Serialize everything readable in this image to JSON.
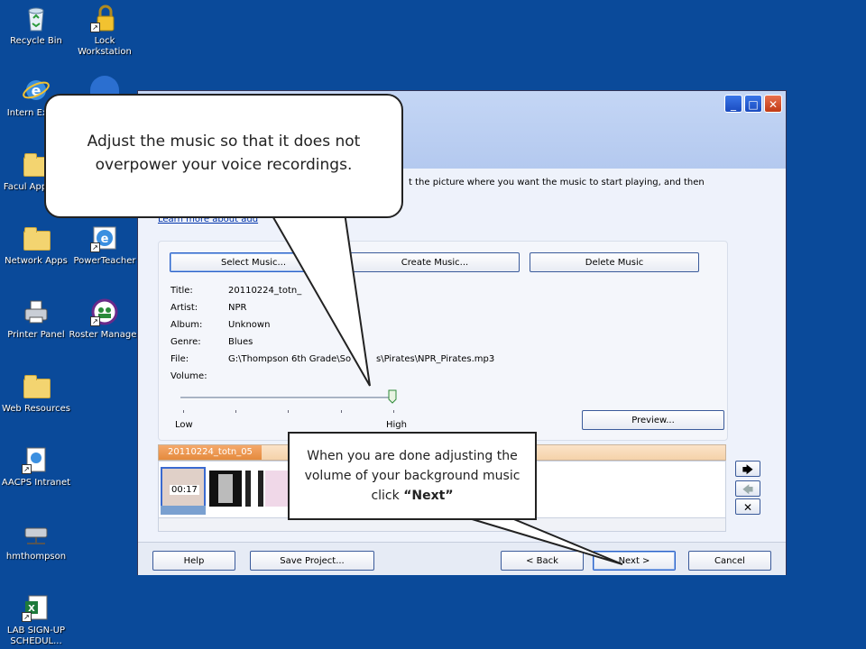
{
  "desktop": {
    "icons": [
      {
        "label": "Recycle Bin",
        "icon": "recycle-bin-icon"
      },
      {
        "label": "Lock Workstation",
        "icon": "lock-icon"
      },
      {
        "label": "Intern Explor",
        "icon": "internet-explorer-icon"
      },
      {
        "label": "Facul Applicati",
        "icon": "folder-icon"
      },
      {
        "label": "Network Apps",
        "icon": "folder-icon"
      },
      {
        "label": "PowerTeacher",
        "icon": "internet-explorer-icon"
      },
      {
        "label": "Printer Panel",
        "icon": "printer-icon"
      },
      {
        "label": "Roster Manager",
        "icon": "roster-icon"
      },
      {
        "label": "Web Resources",
        "icon": "folder-icon"
      },
      {
        "label": "AACPS Intranet",
        "icon": "document-icon"
      },
      {
        "label": "hmthompson",
        "icon": "network-drive-icon"
      },
      {
        "label": "LAB SIGN-UP SCHEDUL...",
        "icon": "excel-icon"
      }
    ]
  },
  "window": {
    "instruction_text": "t the picture where you want the music to start playing, and then",
    "learn_more_link": "Learn more about aud",
    "buttons": {
      "select_music": "Select Music...",
      "create_music": "Create Music...",
      "delete_music": "Delete Music",
      "preview": "Preview...",
      "help": "Help",
      "save_project": "Save Project...",
      "back": "< Back",
      "next": "Next >",
      "cancel": "Cancel"
    },
    "info": {
      "title_label": "Title:",
      "title_value": "20110224_totn_",
      "artist_label": "Artist:",
      "artist_value": "NPR",
      "album_label": "Album:",
      "album_value": "Unknown",
      "genre_label": "Genre:",
      "genre_value": "Blues",
      "file_label": "File:",
      "file_value": "G:\\Thompson 6th Grade\\So",
      "file_value_tail": "s\\Pirates\\NPR_Pirates.mp3",
      "volume_label": "Volume:"
    },
    "volume": {
      "low_label": "Low",
      "high_label": "High",
      "level_fraction": 1.0
    },
    "timeline": {
      "header": "20110224_totn_05",
      "time": "00:17"
    }
  },
  "callouts": {
    "top": "Adjust the music so that it does not overpower your voice recordings.",
    "bottom_part1": "When you are done adjusting the volume of your background music click ",
    "bottom_bold": "“Next”"
  }
}
